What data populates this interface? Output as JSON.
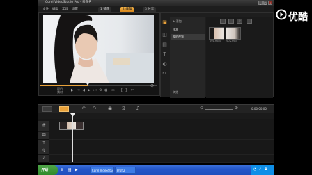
{
  "app": {
    "title": "Corel VideoStudio Pro - 未命名",
    "window_buttons": [
      "_",
      "□",
      "×"
    ]
  },
  "menubar": {
    "items": [
      "文件",
      "编辑",
      "工具",
      "设置"
    ],
    "steps": [
      {
        "label": "1 捕获",
        "active": false
      },
      {
        "label": "2 编辑",
        "active": true
      },
      {
        "label": "3 分享",
        "active": false
      }
    ]
  },
  "preview": {
    "mode_labels": [
      "项目",
      "素材"
    ]
  },
  "library": {
    "add_label": "+ 添加",
    "folders": [
      {
        "label": "样本",
        "selected": false
      },
      {
        "label": "我的视频",
        "selected": true
      }
    ],
    "browse_label": "浏览",
    "thumbs": [
      {
        "label": "V01.mp4"
      },
      {
        "label": "V02.mp4"
      }
    ]
  },
  "timeline": {
    "zoom_readout": "0:00:00:00",
    "track_icons": [
      "🎬",
      "🎞",
      "T",
      "🎙",
      "♪"
    ]
  },
  "taskbar": {
    "start_label": "开始",
    "items": [
      "Corel VideoStudio",
      "Prof 2"
    ]
  },
  "watermark": {
    "text": "优酷"
  },
  "colors": {
    "accent": "#e8a13a",
    "taskbar": "#2456c9",
    "start": "#3a9a34"
  }
}
